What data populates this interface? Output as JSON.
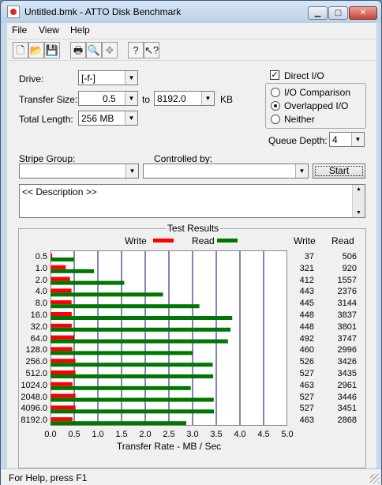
{
  "window": {
    "title": "Untitled.bmk - ATTO Disk Benchmark"
  },
  "menu": [
    "File",
    "View",
    "Help"
  ],
  "toolbar": {
    "icons": [
      "new-icon",
      "open-icon",
      "save-icon",
      "print-icon",
      "print-preview-icon",
      "move-icon",
      "help-icon",
      "context-help-icon"
    ]
  },
  "settings": {
    "drive_label": "Drive:",
    "drive_value": "[-f-]",
    "transfer_label": "Transfer Size:",
    "transfer_from": "0.5",
    "to_label": "to",
    "transfer_to": "8192.0",
    "kb_label": "KB",
    "total_label": "Total Length:",
    "total_value": "256 MB",
    "direct_io_label": "Direct I/O",
    "direct_io_checked": true,
    "io_options": [
      "I/O Comparison",
      "Overlapped I/O",
      "Neither"
    ],
    "io_selected": "Overlapped I/O",
    "queue_label": "Queue Depth:",
    "queue_value": "4",
    "stripe_label": "Stripe Group:",
    "stripe_value": "",
    "controlled_label": "Controlled by:",
    "controlled_value": "",
    "start_label": "Start",
    "description": "<< Description >>"
  },
  "results": {
    "title": "Test Results",
    "write_legend": "Write",
    "read_legend": "Read",
    "write_header": "Write",
    "read_header": "Read",
    "x_axis_label": "Transfer Rate - MB / Sec"
  },
  "colors": {
    "write": "#ff0000",
    "read": "#007700",
    "grid": "#0a0a7a"
  },
  "chart_data": {
    "type": "bar",
    "categories": [
      "0.5",
      "1.0",
      "2.0",
      "4.0",
      "8.0",
      "16.0",
      "32.0",
      "64.0",
      "128.0",
      "256.0",
      "512.0",
      "1024.0",
      "2048.0",
      "4096.0",
      "8192.0"
    ],
    "series": [
      {
        "name": "Write",
        "values": [
          37,
          321,
          412,
          443,
          445,
          448,
          448,
          492,
          460,
          526,
          527,
          463,
          527,
          527,
          463
        ]
      },
      {
        "name": "Read",
        "values": [
          506,
          920,
          1557,
          2376,
          3144,
          3837,
          3801,
          3747,
          2996,
          3426,
          3435,
          2961,
          3446,
          3451,
          2868
        ]
      }
    ],
    "x_ticks": [
      "0.0",
      "0.5",
      "1.0",
      "1.5",
      "2.0",
      "2.5",
      "3.0",
      "3.5",
      "4.0",
      "4.5",
      "5.0"
    ],
    "xlim": [
      0,
      5.0
    ],
    "xlabel": "Transfer Rate - MB / Sec",
    "title": "Test Results"
  },
  "status": {
    "text": "For Help, press F1"
  }
}
